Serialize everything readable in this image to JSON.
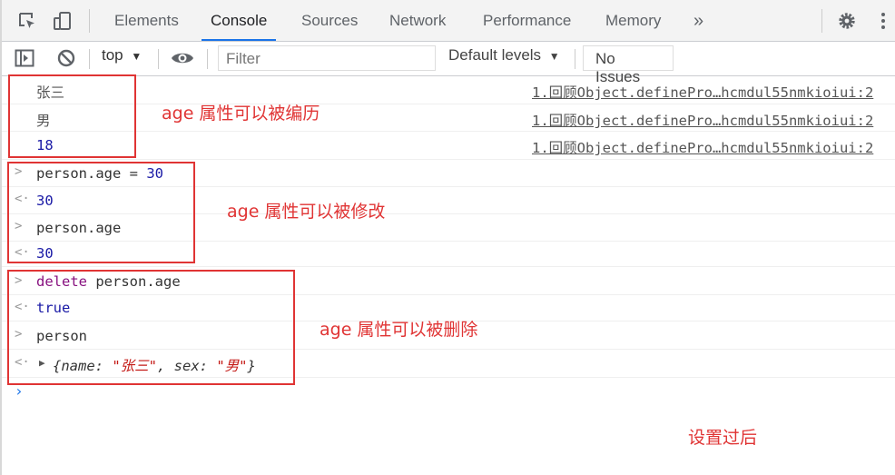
{
  "devtools": {
    "tabs": [
      "Elements",
      "Console",
      "Sources",
      "Network",
      "Performance",
      "Memory"
    ],
    "more_tabs": "»",
    "active_tab": "Console"
  },
  "toolbar": {
    "context": "top",
    "filter_placeholder": "Filter",
    "levels": "Default levels",
    "issues": "No Issues"
  },
  "console": {
    "logs": [
      {
        "value": "张三",
        "source": "1.回顾Object.definePro…hcmdul55nmkioiui:2"
      },
      {
        "value": "男",
        "source": "1.回顾Object.definePro…hcmdul55nmkioiui:2"
      },
      {
        "value": "18",
        "source": "1.回顾Object.definePro…hcmdul55nmkioiui:2"
      }
    ],
    "entries": [
      {
        "obj": "person.age",
        "op": " = ",
        "val": "30"
      },
      {
        "result": "30"
      },
      {
        "input": "person.age"
      },
      {
        "result": "30"
      },
      {
        "keyword": "delete",
        "input": " person.age"
      },
      {
        "result": "true"
      },
      {
        "input": "person"
      },
      {
        "obj_open": "{name: ",
        "name_val": "\"张三\"",
        "mid": ", sex: ",
        "sex_val": "\"男\"",
        "obj_close": "}"
      }
    ]
  },
  "annotations": {
    "enumerable": "age 属性可以被编历",
    "writable": "age 属性可以被修改",
    "deletable": "age 属性可以被删除",
    "after": "设置过后"
  },
  "colors": {
    "annotation": "#e03434",
    "number": "#1a1aa6",
    "keyword": "#881280",
    "string": "#c41a16",
    "accent": "#1a73e8"
  }
}
